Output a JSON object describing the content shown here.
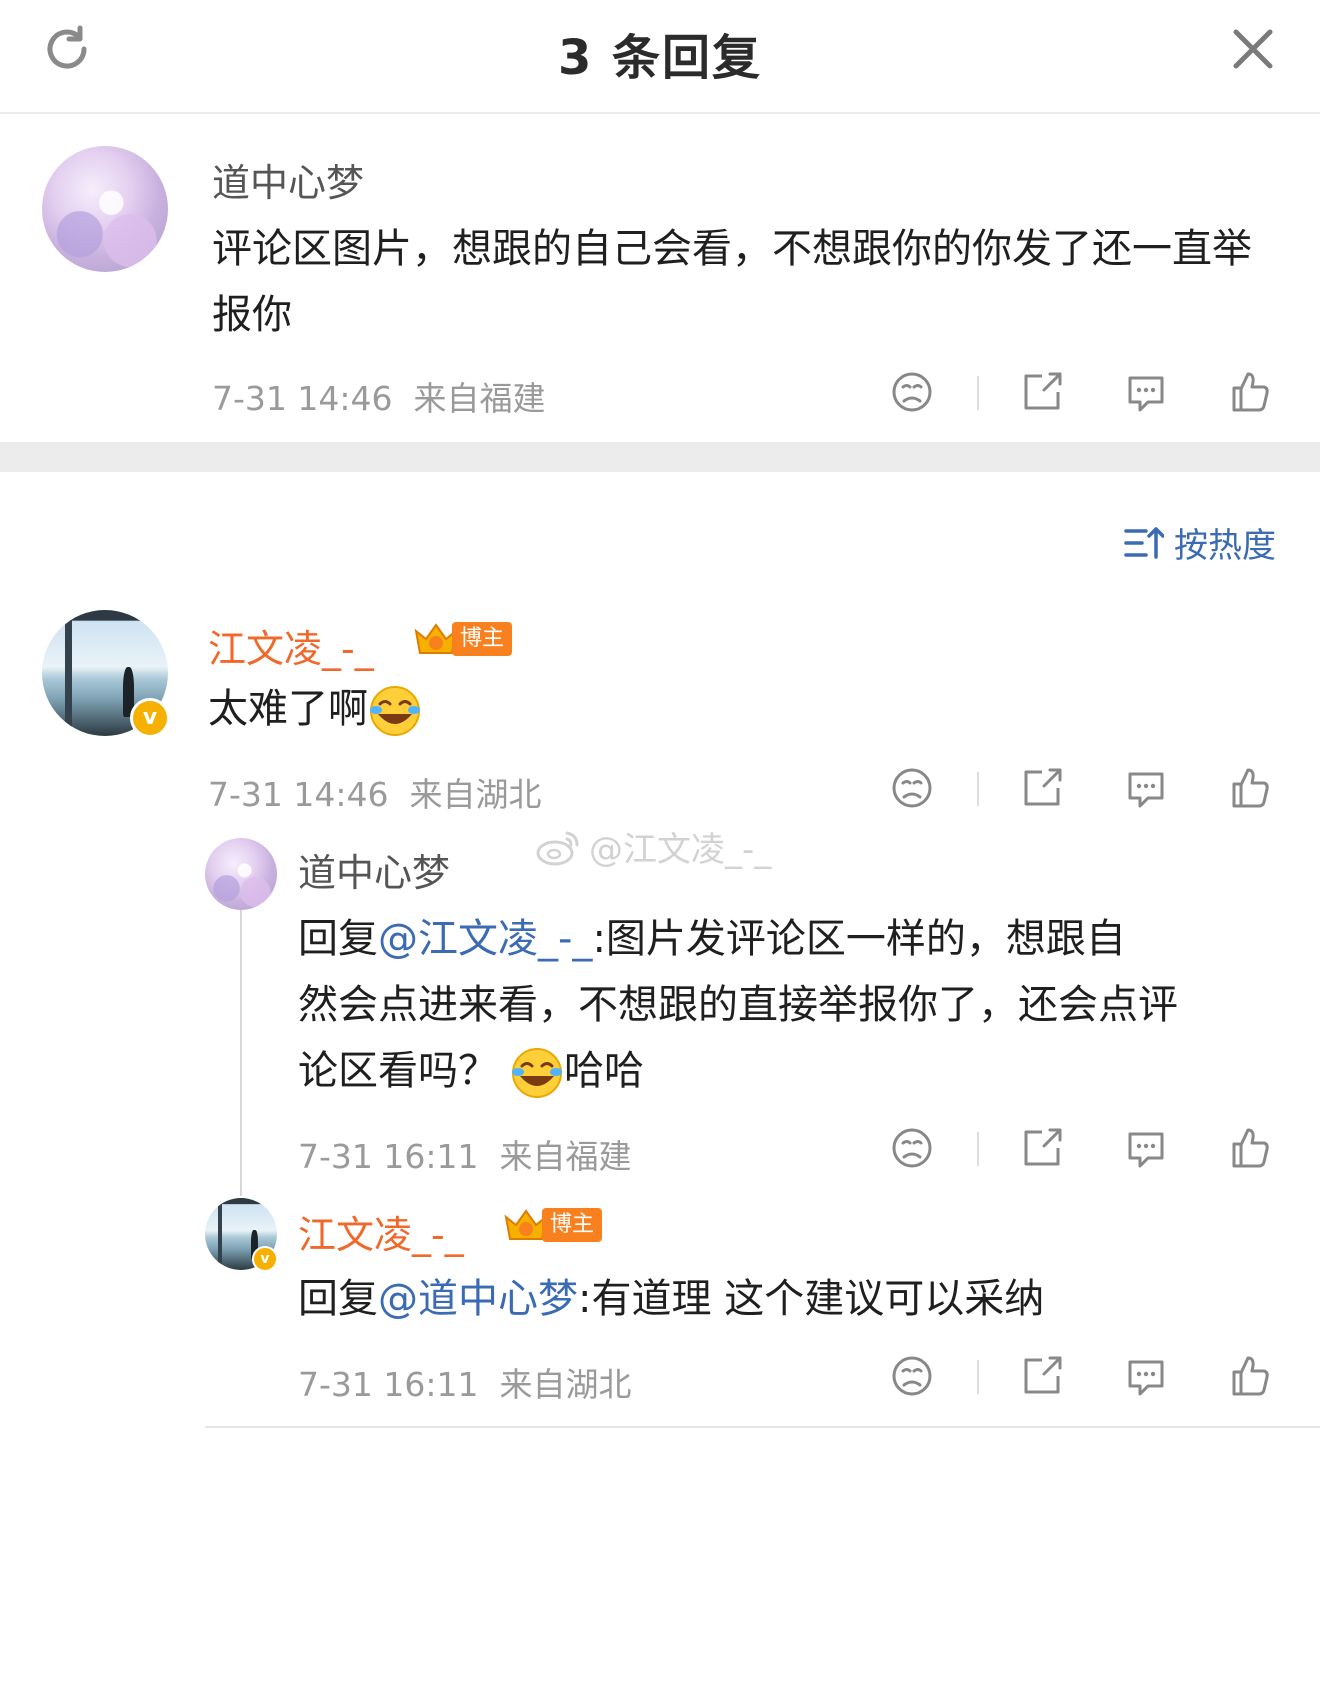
{
  "header": {
    "title": "3 条回复",
    "refresh_icon": "refresh-icon",
    "close_icon": "close-icon"
  },
  "root_comment": {
    "author": "道中心梦",
    "text": "评论区图片，想跟的自己会看，不想跟你的你发了还一直举报你",
    "time": "7-31 14:46",
    "location": "来自福建"
  },
  "sort": {
    "label": "按热度",
    "icon": "sort-icon"
  },
  "replies": [
    {
      "author": "江文凌_-_",
      "badge": "博主",
      "text": "太难了啊",
      "emoji": "laugh-cry-emoji",
      "time": "7-31 14:46",
      "location": "来自湖北"
    },
    {
      "author": "道中心梦",
      "reply_prefix": "回复",
      "mention": "@江文凌_-_",
      "text_line1": ":图片发评论区一样的，想跟自",
      "text_line2": "然会点进来看，不想跟的直接举报你了，还会点评",
      "text_line3": "论区看吗？",
      "text_after_emoji": "哈哈",
      "emoji": "laugh-cry-emoji",
      "time": "7-31 16:11",
      "location": "来自福建"
    },
    {
      "author": "江文凌_-_",
      "badge": "博主",
      "reply_prefix": "回复",
      "mention": "@道中心梦",
      "text": ":有道理 这个建议可以采纳",
      "time": "7-31 16:11",
      "location": "来自湖北"
    }
  ],
  "watermark": "@江文凌_-_",
  "colors": {
    "accent_blue": "#3b6bb3",
    "orange_name": "#f0682a",
    "badge_orange": "#f8801e",
    "meta_gray": "#9a9a9a",
    "verify_yellow": "#f5b000"
  }
}
